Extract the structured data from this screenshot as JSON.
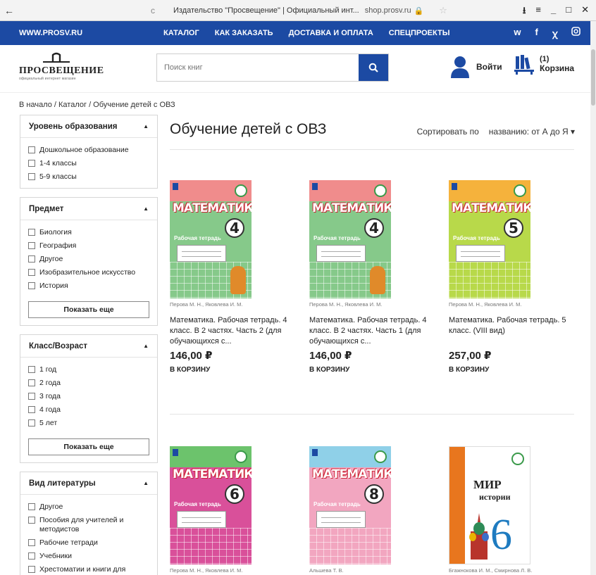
{
  "browser": {
    "back": "←",
    "reload": "c",
    "tab_title": "Издательство \"Просвещение\" | Официальный инт...",
    "domain": "shop.prosv.ru",
    "lock": "🔒",
    "star": "☆",
    "download": "⭳",
    "menu": "≡",
    "minimize": "_",
    "maximize": "□",
    "close": "✕"
  },
  "topnav": {
    "site": "WWW.PROSV.RU",
    "items": [
      "КАТАЛОГ",
      "КАК ЗАКАЗАТЬ",
      "ДОСТАВКА И ОПЛАТА",
      "СПЕЦПРОЕКТЫ"
    ],
    "social": [
      "vk",
      "f",
      "ok",
      "ig"
    ]
  },
  "header": {
    "logo_name": "ПРОСВЕЩЕНИЕ",
    "logo_sub": "официальный интернет магазин",
    "search_placeholder": "Поиск книг",
    "login": "Войти",
    "cart_count": "(1)",
    "cart_label": "Корзина"
  },
  "breadcrumb": "В начало / Каталог / Обучение детей с ОВЗ",
  "filters": [
    {
      "title": "Уровень образования",
      "items": [
        "Дошкольное образование",
        "1-4 классы",
        "5-9 классы"
      ],
      "more": ""
    },
    {
      "title": "Предмет",
      "items": [
        "Биология",
        "География",
        "Другое",
        "Изобразительное искусство",
        "История"
      ],
      "more": "Показать еще"
    },
    {
      "title": "Класс/Возраст",
      "items": [
        "1 год",
        "2 года",
        "3 года",
        "4 года",
        "5 лет"
      ],
      "more": "Показать еще"
    },
    {
      "title": "Вид литературы",
      "items": [
        "Другое",
        "Пособия для учителей и методистов",
        "Рабочие тетради",
        "Учебники",
        "Хрестоматии и книги для чтения"
      ],
      "more": ""
    }
  ],
  "main": {
    "title": "Обучение детей с ОВЗ",
    "sort_label": "Сортировать по",
    "sort_value": "названию: от А до Я ▾",
    "products": [
      {
        "author": "Перова М. Н., Яковлева И. М.",
        "title": "Математика. Рабочая тетрадь. 4 класс. В 2 частях. Часть 2 (для обучающихся с...",
        "price": "146,00 ₽",
        "cart": "В КОРЗИНУ",
        "cover_word": "МАТЕМАТИКА",
        "cover_num": "4",
        "cover_sub": "Рабочая тетрадь",
        "color_top": "#f08c8c",
        "color_bottom": "#86c98a"
      },
      {
        "author": "Перова М. Н., Яковлева И. М.",
        "title": "Математика. Рабочая тетрадь. 4 класс. В 2 частях. Часть 1 (для обучающихся с...",
        "price": "146,00 ₽",
        "cart": "В КОРЗИНУ",
        "cover_word": "МАТЕМАТИКА",
        "cover_num": "4",
        "cover_sub": "Рабочая тетрадь",
        "color_top": "#f08c8c",
        "color_bottom": "#86c98a"
      },
      {
        "author": "Перова М. Н., Яковлева И. М.",
        "title": "Математика. Рабочая тетрадь. 5 класс. (VIII вид)",
        "price": "257,00 ₽",
        "cart": "В КОРЗИНУ",
        "cover_word": "МАТЕМАТИКА",
        "cover_num": "5",
        "cover_sub": "Рабочая тетрадь",
        "color_top": "#f5b23c",
        "color_bottom": "#b8d94a"
      },
      {
        "author": "Перова М. Н., Яковлева И. М.",
        "title": "",
        "price": "",
        "cart": "",
        "cover_word": "МАТЕМАТИКА",
        "cover_num": "6",
        "cover_sub": "Рабочая тетрадь",
        "color_top": "#6cc36c",
        "color_bottom": "#d9509a"
      },
      {
        "author": "Альшева Т. В.",
        "title": "",
        "price": "",
        "cart": "",
        "cover_word": "МАТЕМАТИКА",
        "cover_num": "8",
        "cover_sub": "Рабочая тетрадь",
        "color_top": "#8fd0e8",
        "color_bottom": "#f2a6c0"
      },
      {
        "author": "Бгажнокова И. М., Смирнова Л. В.",
        "title": "",
        "price": "",
        "cart": "",
        "cover_word": "МИР",
        "cover_num": "6",
        "cover_sub": "истории",
        "color_top": "#ffffff",
        "color_bottom": "#ffffff"
      }
    ]
  }
}
